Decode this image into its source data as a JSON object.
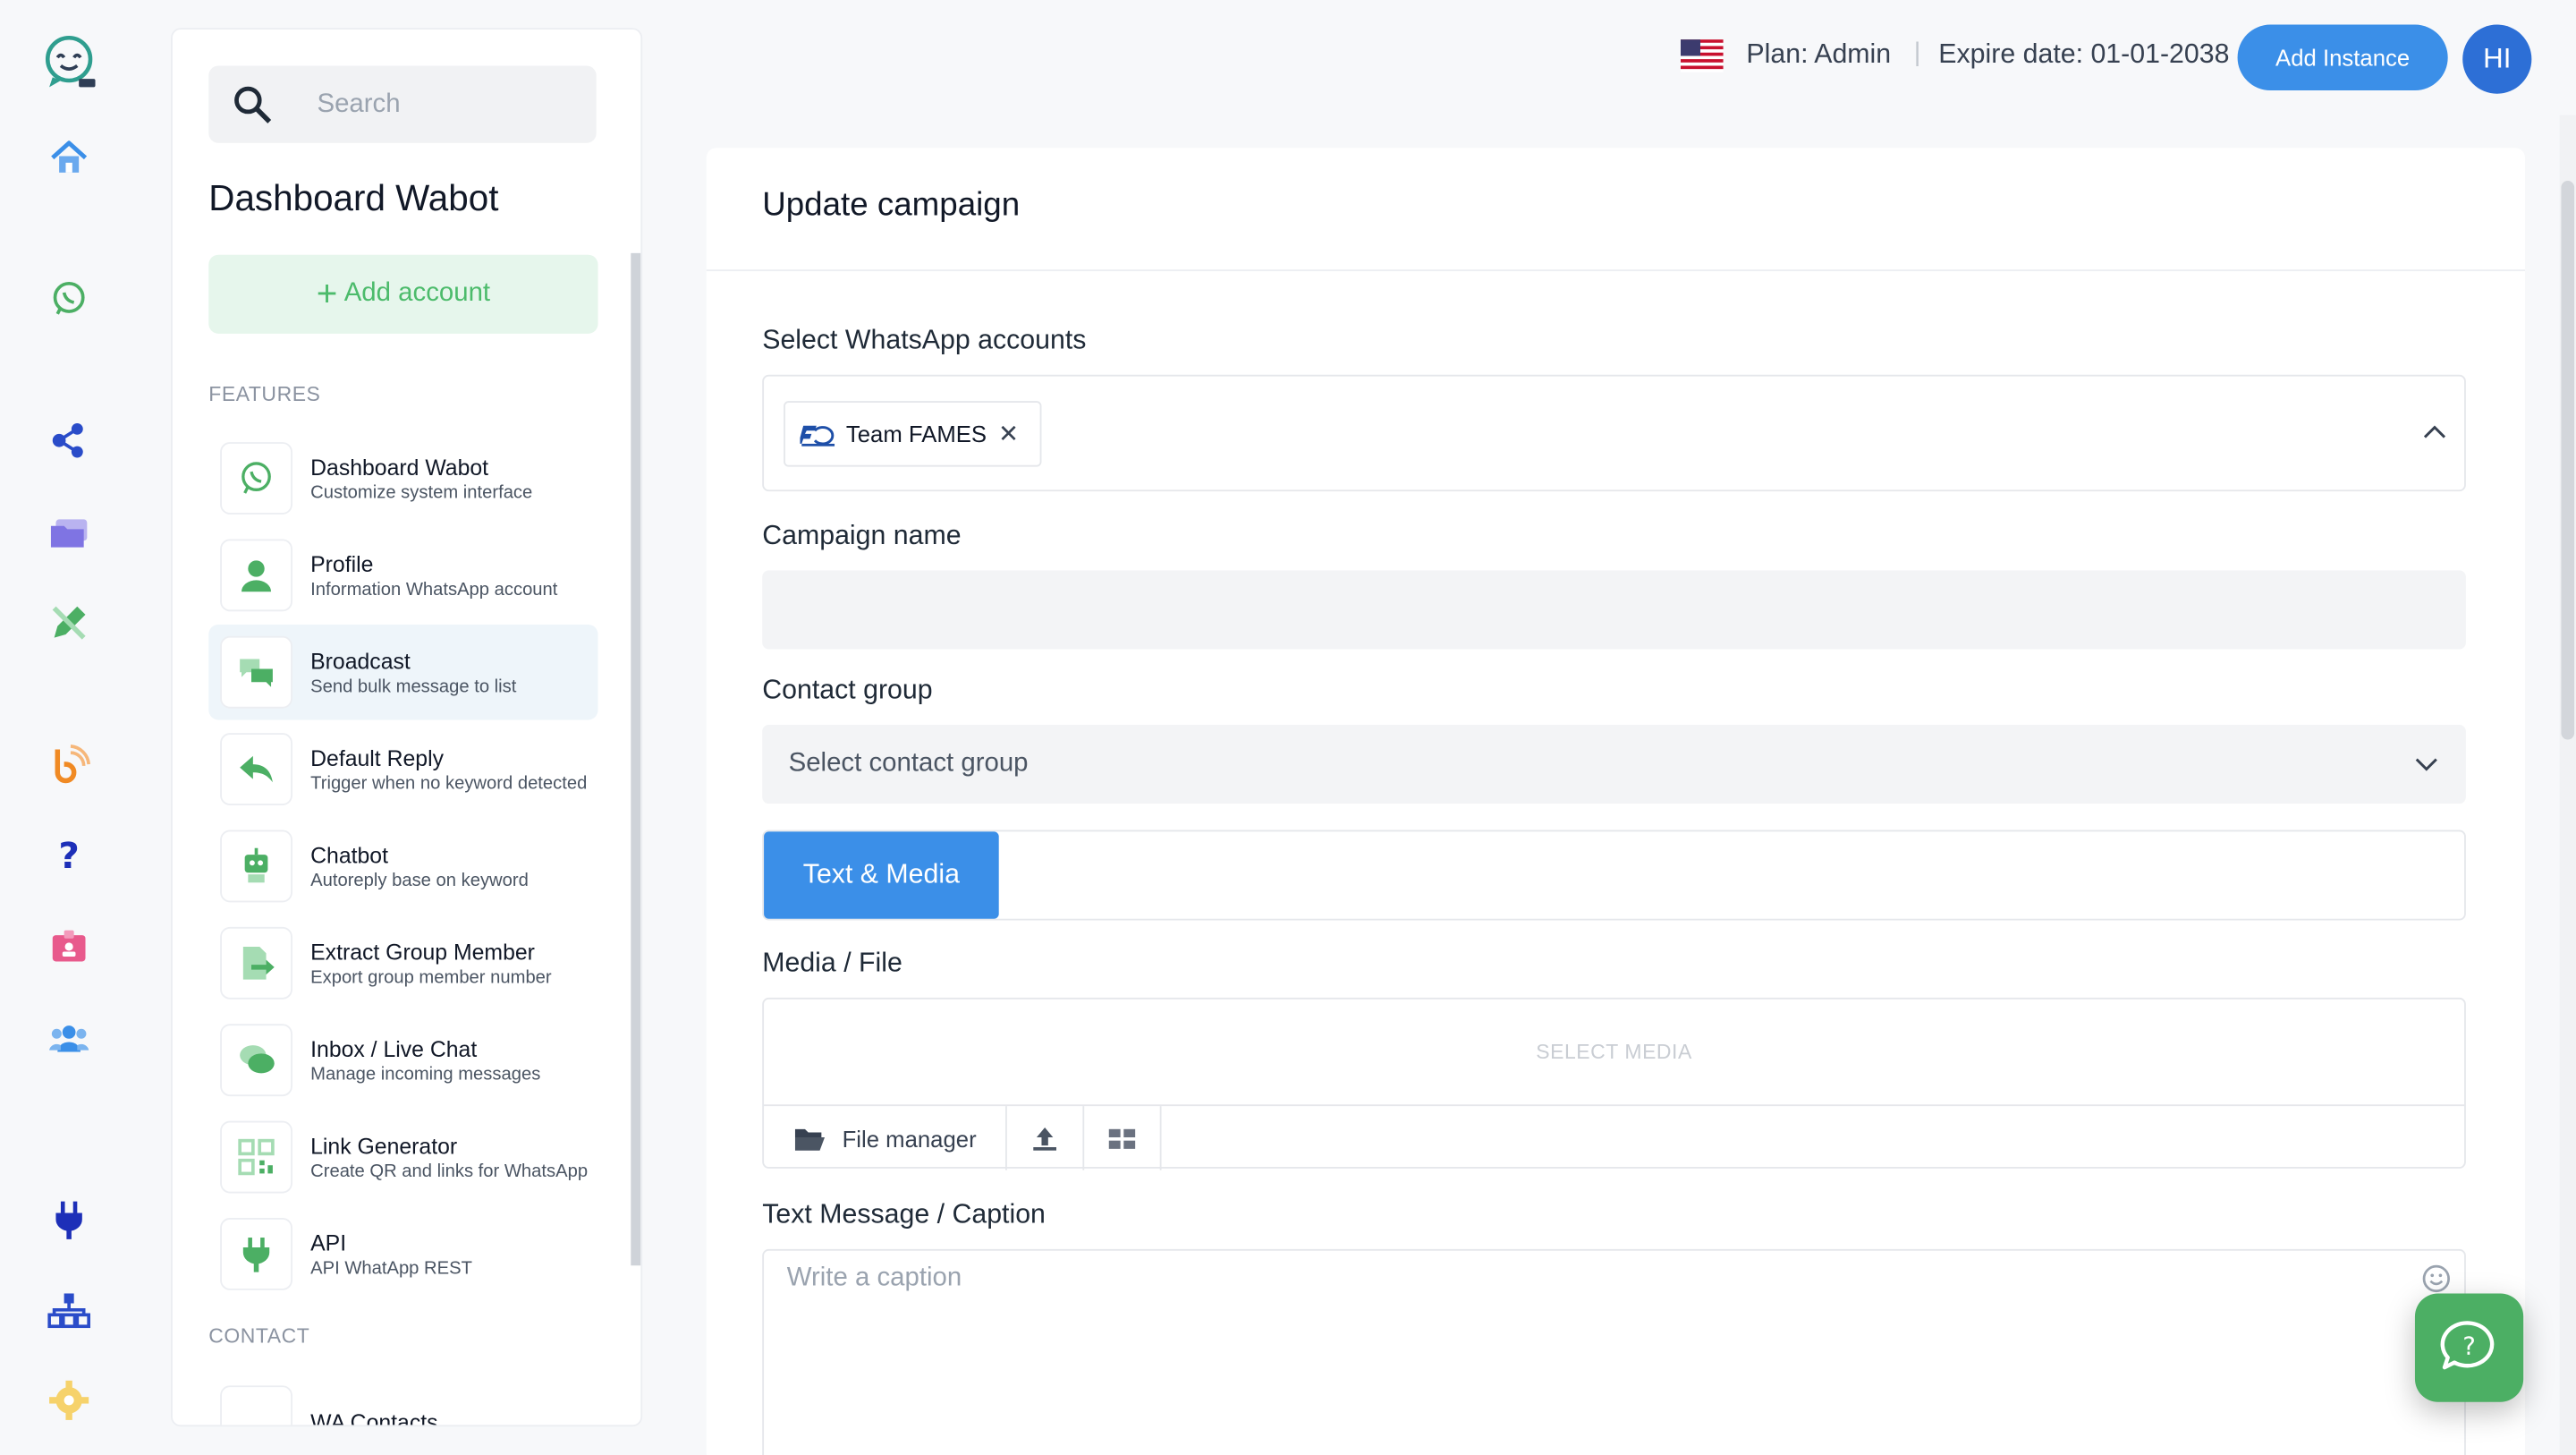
{
  "header": {
    "plan": "Plan: Admin",
    "separator": "|",
    "expire": "Expire date: 01-01-2038",
    "add_instance": "Add Instance",
    "avatar_initials": "HI"
  },
  "sidebar": {
    "search_placeholder": "Search",
    "title": "Dashboard Wabot",
    "add_account": "Add account",
    "features_label": "FEATURES",
    "contact_label": "CONTACT",
    "features": [
      {
        "name": "Dashboard Wabot",
        "desc": "Customize system interface",
        "icon": "whatsapp-icon"
      },
      {
        "name": "Profile",
        "desc": "Information WhatsApp account",
        "icon": "user-icon"
      },
      {
        "name": "Broadcast",
        "desc": "Send bulk message to list",
        "icon": "chat-bubbles-icon"
      },
      {
        "name": "Default Reply",
        "desc": "Trigger when no keyword detected",
        "icon": "reply-icon"
      },
      {
        "name": "Chatbot",
        "desc": "Autoreply base on keyword",
        "icon": "robot-icon"
      },
      {
        "name": "Extract Group Member",
        "desc": "Export group member number",
        "icon": "file-export-icon"
      },
      {
        "name": "Inbox / Live Chat",
        "desc": "Manage incoming messages",
        "icon": "comments-icon"
      },
      {
        "name": "Link Generator",
        "desc": "Create QR and links for WhatsApp",
        "icon": "qrcode-icon"
      },
      {
        "name": "API",
        "desc": "API WhatApp REST",
        "icon": "plug-icon"
      }
    ],
    "contact_partial": "WA Contacts"
  },
  "main": {
    "title": "Update campaign",
    "wa_accounts_label": "Select WhatsApp accounts",
    "wa_chip": "Team FAMES",
    "campaign_name_label": "Campaign name",
    "campaign_name_value": "",
    "contact_group_label": "Contact group",
    "contact_group_value": "Select contact group",
    "tab_active": "Text & Media",
    "media_label": "Media / File",
    "select_media": "SELECT MEDIA",
    "file_manager": "File manager",
    "caption_label": "Text Message / Caption",
    "caption_placeholder": "Write a caption"
  },
  "colors": {
    "accent": "#3b8fe8",
    "green": "#4caf64",
    "green_light": "#e6f6ec",
    "avatar": "#2d6fd6"
  }
}
